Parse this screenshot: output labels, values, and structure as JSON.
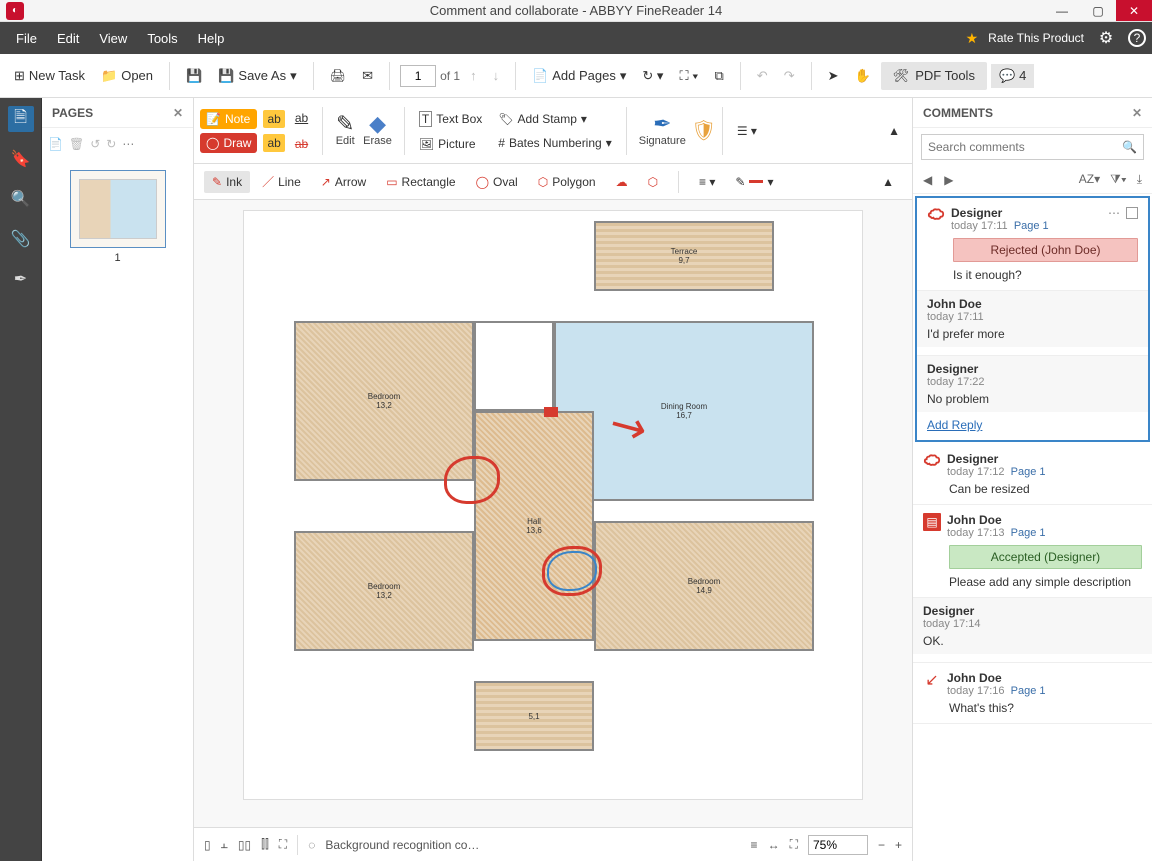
{
  "titlebar": {
    "title": "Comment and collaborate - ABBYY FineReader 14"
  },
  "menubar": {
    "items": [
      "File",
      "Edit",
      "View",
      "Tools",
      "Help"
    ],
    "rate": "Rate This Product"
  },
  "toolbar": {
    "newtask": "New Task",
    "open": "Open",
    "saveas": "Save As",
    "page_current": "1",
    "page_total": "of 1",
    "addpages": "Add Pages",
    "pdftools": "PDF Tools",
    "chat_count": "4"
  },
  "pages_panel": {
    "title": "PAGES",
    "thumb_label": "1"
  },
  "ribbon": {
    "note": "Note",
    "draw": "Draw",
    "edit": "Edit",
    "erase": "Erase",
    "textbox": "Text Box",
    "picture": "Picture",
    "addstamp": "Add Stamp",
    "bates": "Bates Numbering",
    "signature": "Signature"
  },
  "shapebar": {
    "ink": "Ink",
    "line": "Line",
    "arrow": "Arrow",
    "rectangle": "Rectangle",
    "oval": "Oval",
    "polygon": "Polygon"
  },
  "floorplan": {
    "terrace": "Terrace",
    "terrace_dim": "9,7",
    "bedroom1": "Bedroom",
    "bedroom1_dim": "13,2",
    "dining": "Dining Room",
    "dining_dim": "16,7",
    "hall": "Hall",
    "hall_dim": "13,6",
    "bedroom2": "Bedroom",
    "bedroom2_dim": "13,2",
    "bedroom3": "Bedroom",
    "bedroom3_dim": "14,9",
    "porch": "5,1"
  },
  "statusbar": {
    "bg_task": "Background recognition co…",
    "zoom": "75%"
  },
  "comments_panel": {
    "title": "COMMENTS",
    "search_placeholder": "Search comments",
    "sort": "AZ"
  },
  "comments": [
    {
      "icon": "cloud",
      "user": "Designer",
      "time": "today 17:11",
      "page": "Page 1",
      "status": "Rejected (John Doe)",
      "status_kind": "rejected",
      "text": "Is it enough?",
      "replies": [
        {
          "user": "John Doe",
          "time": "today 17:11",
          "text": "I'd prefer more"
        },
        {
          "user": "Designer",
          "time": "today 17:22",
          "text": "No problem"
        }
      ],
      "add_reply": "Add Reply",
      "selected": true,
      "show_menu": true
    },
    {
      "icon": "cloud",
      "user": "Designer",
      "time": "today 17:12",
      "page": "Page 1",
      "text": "Can be resized",
      "replies": []
    },
    {
      "icon": "note",
      "user": "John Doe",
      "time": "today 17:13",
      "page": "Page 1",
      "status": "Accepted (Designer)",
      "status_kind": "accepted",
      "text": "Please add any simple description",
      "replies": [
        {
          "user": "Designer",
          "time": "today 17:14",
          "text": "OK."
        }
      ]
    },
    {
      "icon": "arrow",
      "user": "John Doe",
      "time": "today 17:16",
      "page": "Page 1",
      "text": "What's this?",
      "replies": []
    }
  ]
}
